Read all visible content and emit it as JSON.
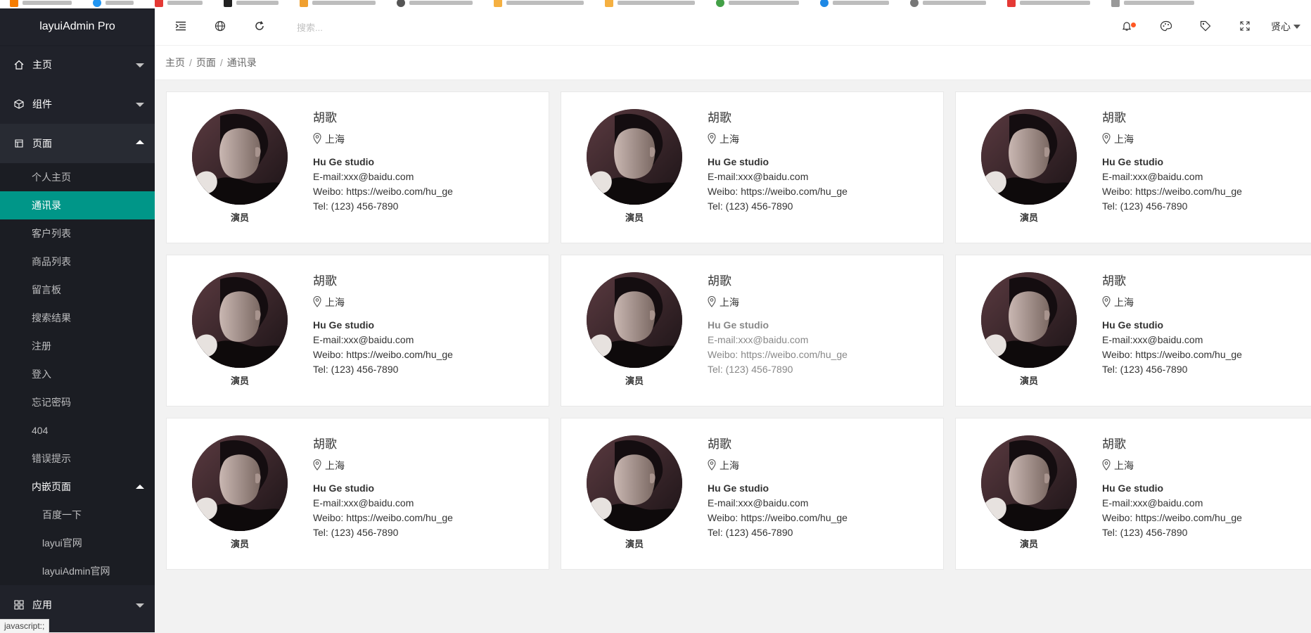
{
  "app": {
    "title": "layuiAdmin Pro"
  },
  "sidebar": {
    "items": [
      {
        "label": "主页",
        "icon": "home-icon",
        "open": false
      },
      {
        "label": "组件",
        "icon": "component-icon",
        "open": false
      },
      {
        "label": "页面",
        "icon": "page-icon",
        "open": true
      }
    ],
    "sub_items": [
      "个人主页",
      "通讯录",
      "客户列表",
      "商品列表",
      "留言板",
      "搜索结果",
      "注册",
      "登入",
      "忘记密码",
      "404",
      "错误提示"
    ],
    "active_sub": "通讯录",
    "nested_group": {
      "label": "内嵌页面",
      "items": [
        "百度一下",
        "layui官网",
        "layuiAdmin官网"
      ]
    },
    "last_item": {
      "label": "应用",
      "icon": "app-icon"
    }
  },
  "header": {
    "search_placeholder": "搜索...",
    "user_name": "贤心",
    "colors": {
      "notification_dot": "#ff5722"
    }
  },
  "breadcrumb": [
    "主页",
    "页面",
    "通讯录"
  ],
  "status_bar": "javascript:;",
  "colors": {
    "sidebar_bg": "#20222a",
    "active": "#009688"
  },
  "contacts": [
    {
      "name": "胡歌",
      "location": "上海",
      "studio": "Hu Ge studio",
      "email": "E-mail:xxx@baidu.com",
      "weibo": "Weibo: https://weibo.com/hu_ge",
      "tel": "Tel: (123) 456-7890",
      "role": "演员"
    },
    {
      "name": "胡歌",
      "location": "上海",
      "studio": "Hu Ge studio",
      "email": "E-mail:xxx@baidu.com",
      "weibo": "Weibo: https://weibo.com/hu_ge",
      "tel": "Tel: (123) 456-7890",
      "role": "演员"
    },
    {
      "name": "胡歌",
      "location": "上海",
      "studio": "Hu Ge studio",
      "email": "E-mail:xxx@baidu.com",
      "weibo": "Weibo: https://weibo.com/hu_ge",
      "tel": "Tel: (123) 456-7890",
      "role": "演员"
    },
    {
      "name": "胡歌",
      "location": "上海",
      "studio": "Hu Ge studio",
      "email": "E-mail:xxx@baidu.com",
      "weibo": "Weibo: https://weibo.com/hu_ge",
      "tel": "Tel: (123) 456-7890",
      "role": "演员"
    },
    {
      "name": "胡歌",
      "location": "上海",
      "studio": "Hu Ge studio",
      "email": "E-mail:xxx@baidu.com",
      "weibo": "Weibo: https://weibo.com/hu_ge",
      "tel": "Tel: (123) 456-7890",
      "role": "演员"
    },
    {
      "name": "胡歌",
      "location": "上海",
      "studio": "Hu Ge studio",
      "email": "E-mail:xxx@baidu.com",
      "weibo": "Weibo: https://weibo.com/hu_ge",
      "tel": "Tel: (123) 456-7890",
      "role": "演员"
    },
    {
      "name": "胡歌",
      "location": "上海",
      "studio": "Hu Ge studio",
      "email": "E-mail:xxx@baidu.com",
      "weibo": "Weibo: https://weibo.com/hu_ge",
      "tel": "Tel: (123) 456-7890",
      "role": "演员"
    },
    {
      "name": "胡歌",
      "location": "上海",
      "studio": "Hu Ge studio",
      "email": "E-mail:xxx@baidu.com",
      "weibo": "Weibo: https://weibo.com/hu_ge",
      "tel": "Tel: (123) 456-7890",
      "role": "演员"
    },
    {
      "name": "胡歌",
      "location": "上海",
      "studio": "Hu Ge studio",
      "email": "E-mail:xxx@baidu.com",
      "weibo": "Weibo: https://weibo.com/hu_ge",
      "tel": "Tel: (123) 456-7890",
      "role": "演员"
    }
  ]
}
